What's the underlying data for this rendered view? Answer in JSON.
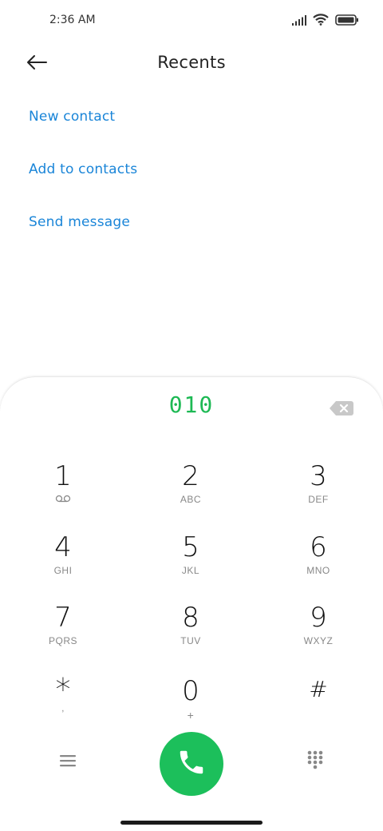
{
  "status_bar": {
    "time": "2:36 AM",
    "icons": [
      "signal-icon",
      "wifi-icon",
      "battery-icon"
    ]
  },
  "header": {
    "title": "Recents",
    "back_icon": "back-arrow-icon"
  },
  "actions": [
    {
      "label": "New contact"
    },
    {
      "label": "Add to contacts"
    },
    {
      "label": "Send message"
    }
  ],
  "dialer": {
    "number": "010",
    "backspace_icon": "backspace-icon",
    "keys": [
      {
        "digit": "1",
        "letters": "",
        "icon": "voicemail-icon"
      },
      {
        "digit": "2",
        "letters": "ABC"
      },
      {
        "digit": "3",
        "letters": "DEF"
      },
      {
        "digit": "4",
        "letters": "GHI"
      },
      {
        "digit": "5",
        "letters": "JKL"
      },
      {
        "digit": "6",
        "letters": "MNO"
      },
      {
        "digit": "7",
        "letters": "PQRS"
      },
      {
        "digit": "8",
        "letters": "TUV"
      },
      {
        "digit": "9",
        "letters": "WXYZ"
      },
      {
        "digit": "*",
        "letters": ","
      },
      {
        "digit": "0",
        "letters": "+"
      },
      {
        "digit": "#",
        "letters": ""
      }
    ]
  },
  "bottom_bar": {
    "menu_icon": "menu-icon",
    "call_icon": "phone-icon",
    "keypad_icon": "dialpad-icon"
  },
  "colors": {
    "accent_blue": "#1a85d8",
    "accent_green": "#1cbf5b",
    "number_green": "#1db954"
  }
}
